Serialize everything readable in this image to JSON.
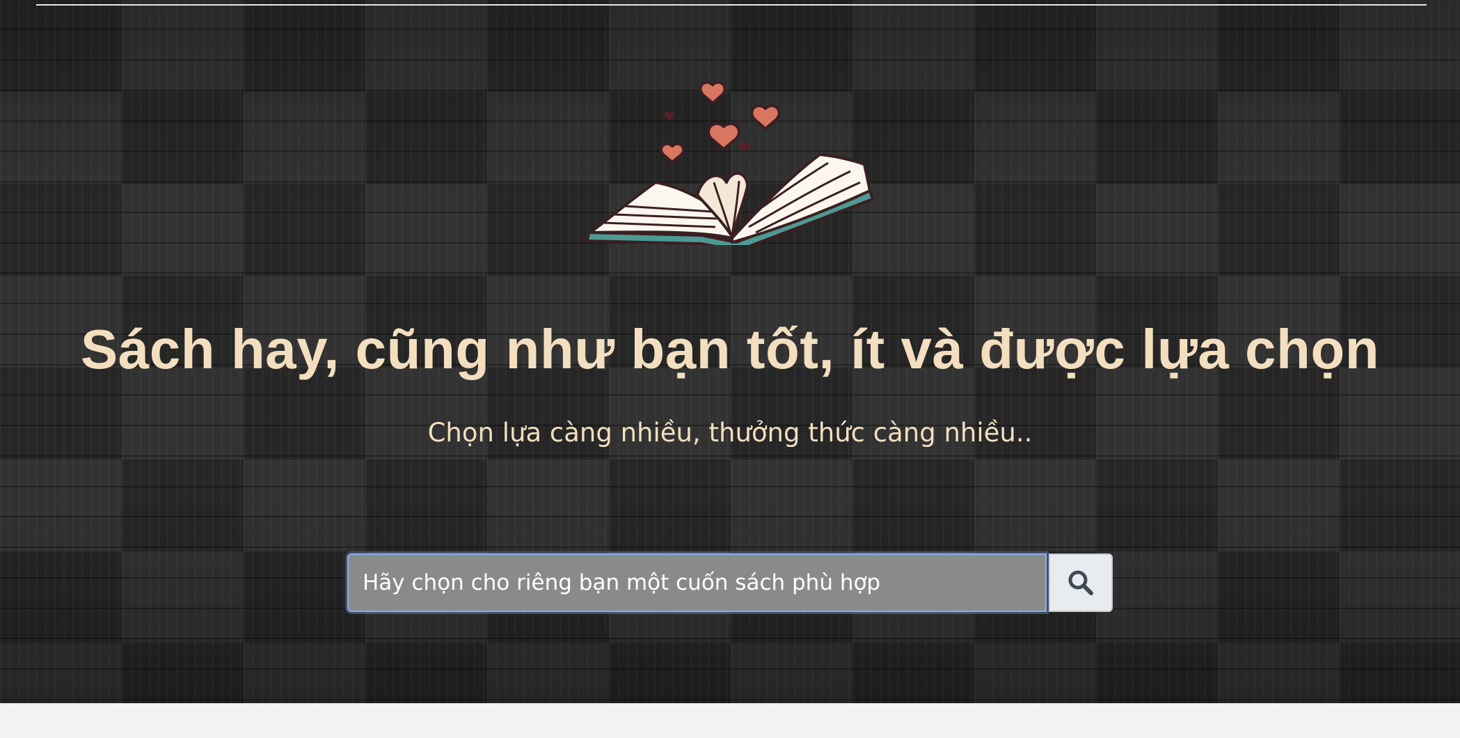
{
  "hero": {
    "headline": "Sách hay, cũng như bạn tốt, ít và được lựa chọn",
    "subheadline": "Chọn lựa càng nhiều, thưởng thức càng nhiều..",
    "logo_icon": "open-book-with-hearts-icon"
  },
  "search": {
    "placeholder": "Hãy chọn cho riêng bạn một cuốn sách phù hợp",
    "value": "",
    "button_icon": "search-icon"
  },
  "colors": {
    "headline": "#f3dfbf",
    "input_background": "#8a8a8a",
    "button_background": "#e9ecef",
    "heart": "#d9765f",
    "book_outline": "#3a1f22",
    "book_cover": "#4d9a93"
  }
}
